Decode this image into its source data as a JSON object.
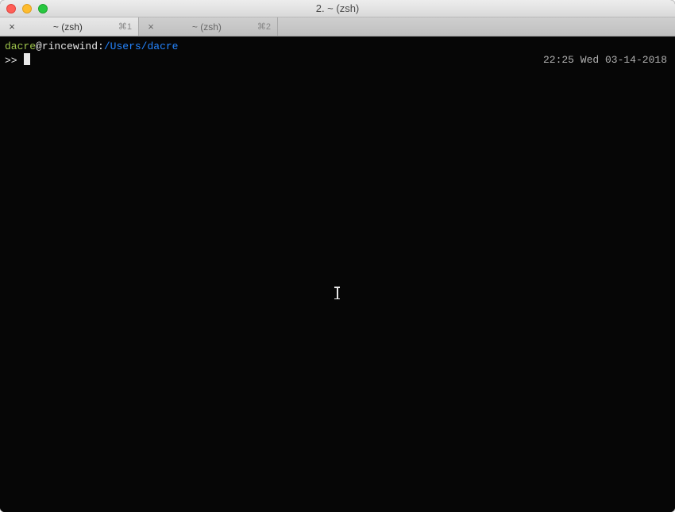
{
  "window": {
    "title": "2. ~ (zsh)"
  },
  "tabs": [
    {
      "label": "~ (zsh)",
      "shortcut": "⌘1",
      "active": true
    },
    {
      "label": "~ (zsh)",
      "shortcut": "⌘2",
      "active": false
    }
  ],
  "prompt": {
    "user": "dacre",
    "at": "@",
    "host": "rincewind",
    "sep": ":",
    "path": "/Users/dacre",
    "ps1": ">> "
  },
  "rprompt": "22:25 Wed 03-14-2018"
}
